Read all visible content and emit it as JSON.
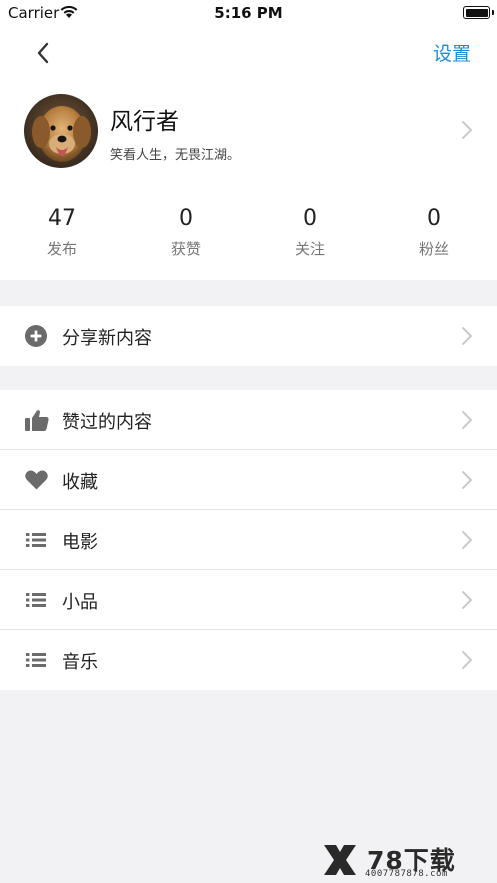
{
  "status_bar": {
    "carrier": "Carrier",
    "time": "5:16 PM"
  },
  "nav": {
    "back_icon": "chevron-left-icon",
    "settings_label": "设置"
  },
  "profile": {
    "username": "风行者",
    "bio": "笑看人生，无畏江湖。",
    "avatar": "golden-retriever-photo"
  },
  "stats": [
    {
      "value": "47",
      "label": "发布"
    },
    {
      "value": "0",
      "label": "获赞"
    },
    {
      "value": "0",
      "label": "关注"
    },
    {
      "value": "0",
      "label": "粉丝"
    }
  ],
  "share_section": {
    "label": "分享新内容",
    "icon": "plus-circle-icon"
  },
  "menu": [
    {
      "label": "赞过的内容",
      "icon": "thumbs-up-icon"
    },
    {
      "label": "收藏",
      "icon": "heart-icon"
    },
    {
      "label": "电影",
      "icon": "list-icon"
    },
    {
      "label": "小品",
      "icon": "list-icon"
    },
    {
      "label": "音乐",
      "icon": "list-icon"
    }
  ],
  "watermark": {
    "brand": "78下载",
    "phone": "4007787878.com"
  },
  "colors": {
    "accent": "#1a8fd9",
    "background": "#f2f2f4",
    "icon": "#6b6b6b"
  }
}
